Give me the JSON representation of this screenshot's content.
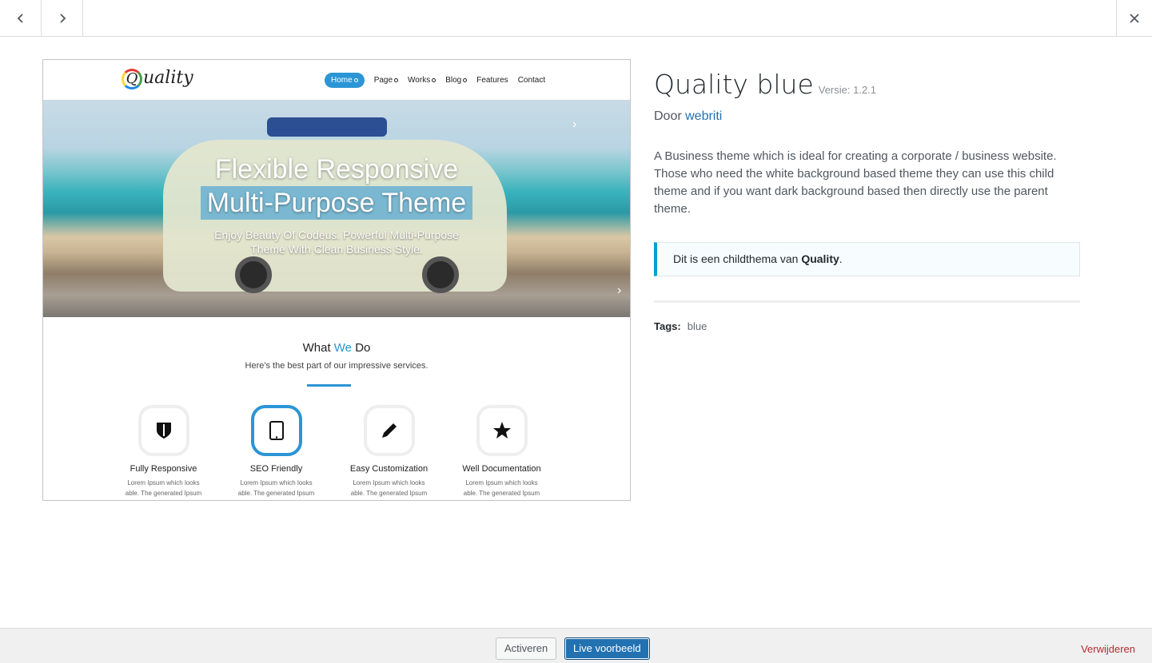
{
  "topbar": {
    "prev_icon": "chevron-left",
    "next_icon": "chevron-right",
    "close_icon": "close"
  },
  "screenshot": {
    "logo_text": "uality",
    "logo_letter": "Q",
    "nav": [
      "Home",
      "Page",
      "Works",
      "Blog",
      "Features",
      "Contact"
    ],
    "hero_title_line1": "Flexible Responsive",
    "hero_title_line2": "Multi-Purpose Theme",
    "hero_subtitle_line1": "Enjoy Beauty Of Codeus. Powerful Multi-Purpose",
    "hero_subtitle_line2": "Theme With Clean Business Style.",
    "section_title_pre": "What ",
    "section_title_we": "We",
    "section_title_post": " Do",
    "section_sub": "Here's the best part of our impressive services.",
    "features": [
      {
        "name": "Fully Responsive",
        "desc1": "Lorem Ipsum which looks",
        "desc2": "able. The generated Ipsum"
      },
      {
        "name": "SEO Friendly",
        "desc1": "Lorem Ipsum which looks",
        "desc2": "able. The generated Ipsum"
      },
      {
        "name": "Easy Customization",
        "desc1": "Lorem Ipsum which looks",
        "desc2": "able. The generated Ipsum"
      },
      {
        "name": "Well Documentation",
        "desc1": "Lorem Ipsum which looks",
        "desc2": "able. The generated Ipsum"
      }
    ],
    "accent_color": "#2b95d6"
  },
  "theme": {
    "name": "Quality blue",
    "version_label": "Versie: 1.2.1",
    "author_prefix": "Door ",
    "author": "webriti",
    "description": "A Business theme which is ideal for creating a corporate / business website. Those who need the white background based theme they can use this child theme and if you want dark background based then directly use the parent theme.",
    "child_notice_prefix": "Dit is een childthema van ",
    "parent_name": "Quality",
    "child_notice_suffix": ".",
    "tags_label": "Tags:",
    "tags": "blue"
  },
  "actions": {
    "activate": "Activeren",
    "live_preview": "Live voorbeeld",
    "delete": "Verwijderen"
  }
}
